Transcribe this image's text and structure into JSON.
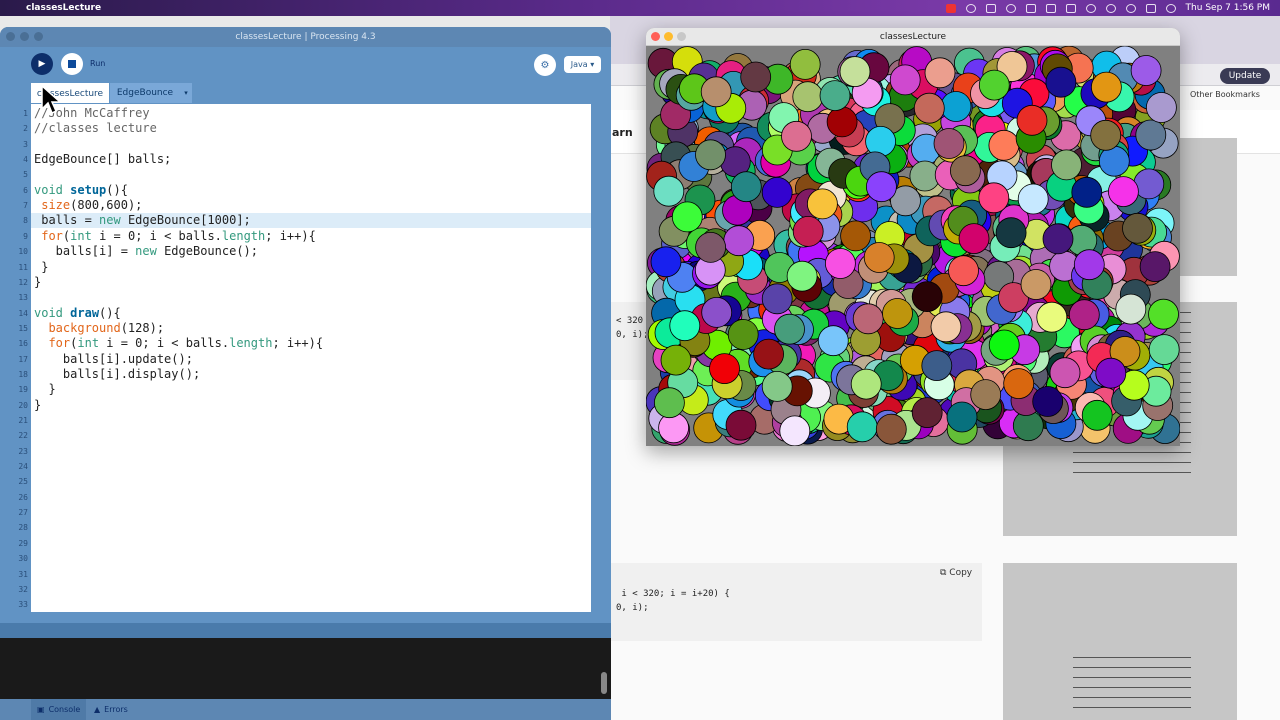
{
  "menubar": {
    "app_name": "classesLecture",
    "clock": "Thu Sep 7  1:56 PM"
  },
  "browser": {
    "update_label": "Update",
    "other_bookmarks": "Other Bookmarks",
    "nav_text": "arn",
    "code_snip_1": "< 320\n0, i);",
    "code_snip_2": " i < 320; i = i+20) {\n0, i);",
    "copy_label": "Copy"
  },
  "ide": {
    "title": "classesLecture | Processing 4.3",
    "run_label": "Run",
    "mode": "Java ▾",
    "tabs": [
      "classesLecture",
      "EdgeBounce"
    ],
    "tab_menu": "▾",
    "lines": [
      "//John McCaffrey",
      "//classes lecture",
      "",
      "EdgeBounce[] balls;",
      "",
      "void setup(){",
      " size(800,600);",
      " balls = new EdgeBounce[1000];",
      " for(int i = 0; i < balls.length; i++){",
      "   balls[i] = new EdgeBounce();",
      " }",
      "}",
      "",
      "void draw(){",
      "  background(128);",
      "  for(int i = 0; i < balls.length; i++){",
      "    balls[i].update();",
      "    balls[i].display();",
      "  }",
      "}"
    ],
    "line_count": 33,
    "console_label": "Console",
    "errors_label": "Errors"
  },
  "sketch": {
    "title": "classesLecture",
    "ball_count": 1000
  }
}
